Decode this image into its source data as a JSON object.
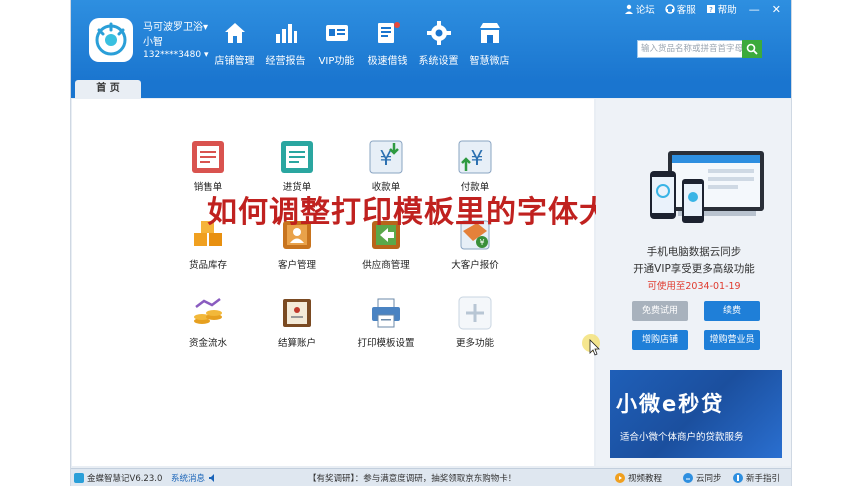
{
  "header": {
    "shop_name": "马可波罗卫浴▾",
    "user_name": "小智",
    "phone": "132****3480 ▾",
    "search_placeholder": "输入货品名称或拼音首字母"
  },
  "topbar": {
    "forum": "论坛",
    "service": "客服",
    "help": "帮助",
    "minimize": "—",
    "close": "✕"
  },
  "nav": [
    {
      "label": "店铺管理",
      "icon": "home-icon"
    },
    {
      "label": "经营报告",
      "icon": "bar-chart-icon"
    },
    {
      "label": "VIP功能",
      "icon": "vip-card-icon"
    },
    {
      "label": "极速借钱",
      "icon": "loan-icon"
    },
    {
      "label": "系统设置",
      "icon": "gear-icon"
    },
    {
      "label": "智慧微店",
      "icon": "store-icon"
    }
  ],
  "tabs": {
    "home": "首 页"
  },
  "tiles": [
    {
      "label": "销售单"
    },
    {
      "label": "进货单"
    },
    {
      "label": "收款单"
    },
    {
      "label": "付款单"
    },
    {
      "label": "货品库存"
    },
    {
      "label": "客户管理"
    },
    {
      "label": "供应商管理"
    },
    {
      "label": "大客户报价"
    },
    {
      "label": "资金流水"
    },
    {
      "label": "结算账户"
    },
    {
      "label": "打印模板设置"
    },
    {
      "label": "更多功能"
    }
  ],
  "overlay_title": "如何调整打印模板里的字体大小",
  "right_panel": {
    "line1": "手机电脑数据云同步",
    "line2": "开通VIP享受更多高级功能",
    "expiry": "可使用至2034-01-19",
    "btn_trial": "免费试用",
    "btn_renew": "续费",
    "btn_add_store": "增购店铺",
    "btn_add_staff": "增购营业员",
    "banner_title": "小微e秒贷",
    "banner_sub": "适合小微个体商户的贷款服务"
  },
  "status": {
    "version": "金蝶智慧记V6.23.0",
    "messages": "系统消息",
    "news": "【有奖调研】：参与满意度调研，抽奖领取京东购物卡！",
    "video": "视频教程",
    "cloud": "云同步",
    "guide": "新手指引"
  },
  "colors": {
    "header_blue": "#1a75cf",
    "button_blue": "#1f7fd8",
    "button_gray": "#a8b2bd",
    "overlay_red": "#c0211f",
    "expiry_red": "#e03b2f"
  }
}
